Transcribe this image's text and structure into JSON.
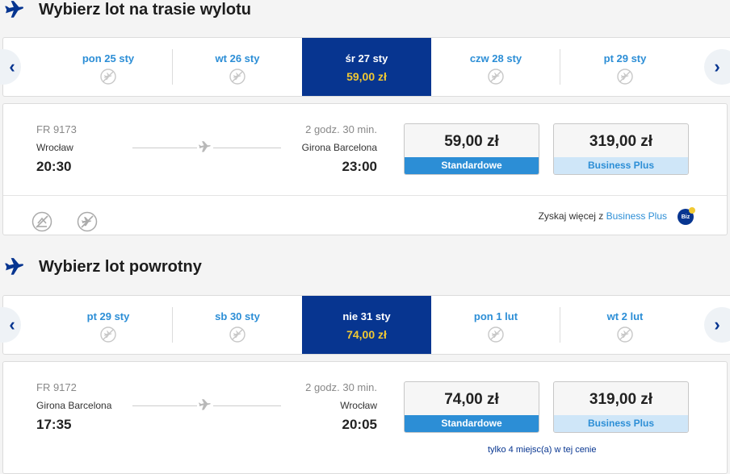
{
  "outbound": {
    "title": "Wybierz lot na trasie wylotu",
    "days": [
      {
        "label": "pon 25 sty"
      },
      {
        "label": "wt 26 sty"
      },
      {
        "label": "śr 27 sty",
        "price": "59,00 zł",
        "selected": true
      },
      {
        "label": "czw 28 sty"
      },
      {
        "label": "pt 29 sty"
      }
    ],
    "flight": {
      "number": "FR 9173",
      "from": "Wrocław",
      "departure": "20:30",
      "duration": "2 godz. 30 min.",
      "to": "Girona Barcelona",
      "arrival": "23:00",
      "standard_price": "59,00 zł",
      "standard_label": "Standardowe",
      "business_price": "319,00 zł",
      "business_label": "Business Plus"
    },
    "upsell_text": "Zyskaj więcej z ",
    "upsell_link": "Business Plus",
    "badge": "Biz"
  },
  "return": {
    "title": "Wybierz lot powrotny",
    "days": [
      {
        "label": "pt 29 sty"
      },
      {
        "label": "sb 30 sty"
      },
      {
        "label": "nie 31 sty",
        "price": "74,00 zł",
        "selected": true
      },
      {
        "label": "pon 1 lut"
      },
      {
        "label": "wt 2 lut"
      }
    ],
    "flight": {
      "number": "FR 9172",
      "from": "Girona Barcelona",
      "departure": "17:35",
      "duration": "2 godz. 30 min.",
      "to": "Wrocław",
      "arrival": "20:05",
      "standard_price": "74,00 zł",
      "standard_label": "Standardowe",
      "business_price": "319,00 zł",
      "business_label": "Business Plus"
    },
    "seats_note": "tylko 4 miejsc(a) w tej cenie"
  },
  "nav": {
    "prev": "‹",
    "next": "›"
  },
  "colors": {
    "brand_dark": "#073590",
    "accent_blue": "#2c8ed6",
    "price_yellow": "#f1c933"
  }
}
